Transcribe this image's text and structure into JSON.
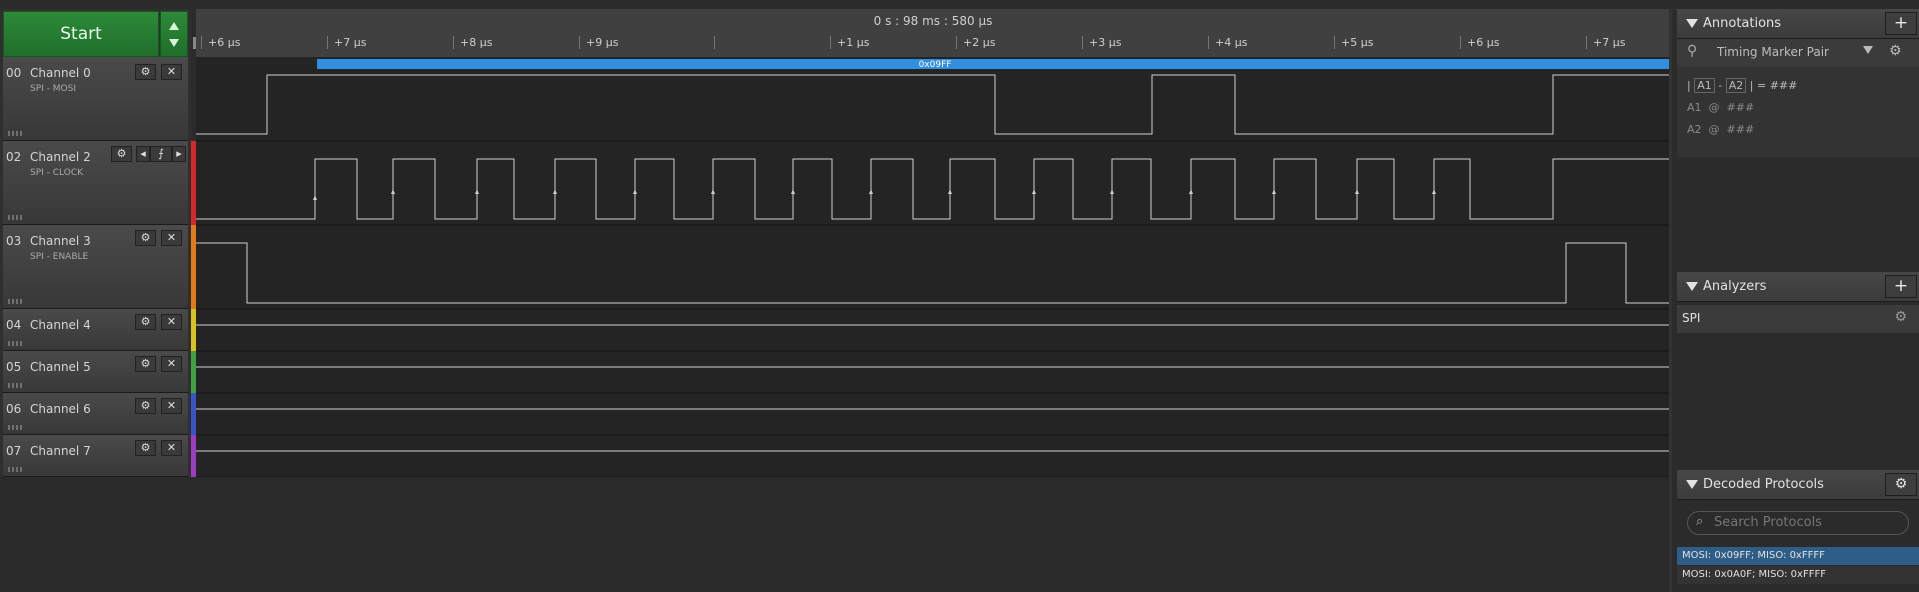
{
  "start_button": {
    "label": "Start"
  },
  "timeline": {
    "center_time": "0 s : 98 ms : 580 µs",
    "ticks": [
      "+6 µs",
      "+7 µs",
      "+8 µs",
      "+9 µs",
      "+1 µs",
      "+2 µs",
      "+3 µs",
      "+4 µs",
      "+5 µs",
      "+6 µs",
      "+7 µs"
    ]
  },
  "decoded_bar_label": "0x09FF",
  "channels": [
    {
      "num": "00",
      "name": "Channel 0",
      "sub": "SPI - MOSI",
      "color": "#d12a2a"
    },
    {
      "num": "02",
      "name": "Channel 2",
      "sub": "SPI - CLOCK",
      "color": "#d12a2a"
    },
    {
      "num": "03",
      "name": "Channel 3",
      "sub": "SPI - ENABLE",
      "color": "#e07a1a"
    },
    {
      "num": "04",
      "name": "Channel 4",
      "sub": "",
      "color": "#d7c21f"
    },
    {
      "num": "05",
      "name": "Channel 5",
      "sub": "",
      "color": "#3fa13f"
    },
    {
      "num": "06",
      "name": "Channel 6",
      "sub": "",
      "color": "#3555c8"
    },
    {
      "num": "07",
      "name": "Channel 7",
      "sub": "",
      "color": "#9b3bc6"
    }
  ],
  "right_panel": {
    "annotations": {
      "title": "Annotations",
      "add_label": "+",
      "marker_pair": "Timing Marker Pair",
      "formula": {
        "bar1": "|",
        "a1": "A1",
        "dash": "-",
        "a2": "A2",
        "bar2": "|",
        "eq": "= ###"
      },
      "a1_line": {
        "label": "A1",
        "at": "@",
        "value": "###"
      },
      "a2_line": {
        "label": "A2",
        "at": "@",
        "value": "###"
      }
    },
    "analyzers": {
      "title": "Analyzers",
      "add_label": "+",
      "items": [
        "SPI"
      ]
    },
    "decoded": {
      "title": "Decoded Protocols",
      "search_placeholder": "Search Protocols",
      "rows": [
        "MOSI: 0x09FF;  MISO: 0xFFFF",
        "MOSI: 0x0A0F;  MISO: 0xFFFF"
      ]
    }
  },
  "colors": {
    "accent_green": "#2e8a3a",
    "decode_blue": "#2f8fe0",
    "selected_row": "#2e5e86"
  }
}
